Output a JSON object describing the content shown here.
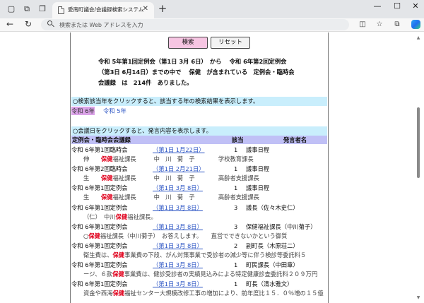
{
  "browser": {
    "tab_title": "愛南町議会/会議録検索システム",
    "tab_close": "✕",
    "new_tab": "+",
    "address_placeholder": "検索または Web アドレスを入力",
    "minimize": "—",
    "maximize": "☐",
    "close": "✕"
  },
  "buttons": {
    "search": "検索",
    "reset": "リセット"
  },
  "summary": {
    "line1": "令和 5年第1回定例会（第1日 3月 6日）　から　 令和 6年第2回定例会",
    "line2": "（第3日 6月14日）までの中で　 保健　が含まれている　定例会・臨時会",
    "line3": "会議録　は　214件　ありました。"
  },
  "year_guide": "○検索該当年をクリックすると、該当する年の検索結果を表示します。",
  "years": [
    "令和 6年",
    "令和 5年"
  ],
  "meeting_guide": "○会議日をクリックすると、発言内容を表示します。",
  "table_headers": {
    "meeting": "定例会・臨時会会議録",
    "item": "該当",
    "speaker": "発言者名"
  },
  "results": [
    {
      "meeting": "令和 6年第1回臨時会",
      "date": "（第1日 1月22日）",
      "num": "1",
      "speaker": "議事日程",
      "snippet_pre": "伸　　",
      "snippet_hit": "保健",
      "snippet_post": "福祉課長　　　中　川　菊　子　　　　学校教育課長"
    },
    {
      "meeting": "令和 6年第2回臨時会",
      "date": "（第1日 2月21日）",
      "num": "1",
      "speaker": "議事日程",
      "snippet_pre": "生　　",
      "snippet_hit": "保健",
      "snippet_post": "福祉課長　　　中　川　菊　子　　　　高齢者支援課長"
    },
    {
      "meeting": "令和 6年第1回定例会",
      "date": "（第1日 3月 8日）",
      "num": "1",
      "speaker": "議事日程",
      "snippet_pre": "生　　",
      "snippet_hit": "保健",
      "snippet_post": "福祉課長　　　中　川　菊　子　　　　高齢者支援課長"
    },
    {
      "meeting": "令和 6年第1回定例会",
      "date": "（第1日 3月 8日）",
      "num": "3",
      "speaker": "議長（佐々木史仁）",
      "snippet_pre": "（仁）　中川",
      "snippet_hit": "保健",
      "snippet_post": "福祉課長。"
    },
    {
      "meeting": "令和 6年第1回定例会",
      "date": "（第1日 3月 8日）",
      "num": "3",
      "speaker": "保健福祉課長（中川菊子）",
      "snippet_pre": "○",
      "snippet_hit": "保健",
      "snippet_post": "福祉課長（中川菊子）　お答えします。　　直営でできないかという御質"
    },
    {
      "meeting": "令和 6年第1回定例会",
      "date": "（第1日 3月 8日）",
      "num": "2",
      "speaker": "副町長（木原荘二）",
      "snippet_pre": "衛生費は、",
      "snippet_hit": "保健",
      "snippet_post": "事業費の下段、がん対策事業で受診者の減少等に伴う検診等委託料５"
    },
    {
      "meeting": "令和 6年第1回定例会",
      "date": "（第1日 3月 8日）",
      "num": "1",
      "speaker": "町民課長（中田章）",
      "snippet_pre": "ージ、６款",
      "snippet_hit": "保健",
      "snippet_post": "事業費は、健診受診者の実績見込みによる特定健康診査委託料２０９万円"
    },
    {
      "meeting": "令和 6年第1回定例会",
      "date": "（第1日 3月 8日）",
      "num": "1",
      "speaker": "町長（清水雅文）",
      "snippet_pre": "資金や西海",
      "snippet_hit": "保健",
      "snippet_post": "福祉センター大規模改修工事の増加により、前年度比１５．０％増の１５億"
    }
  ]
}
